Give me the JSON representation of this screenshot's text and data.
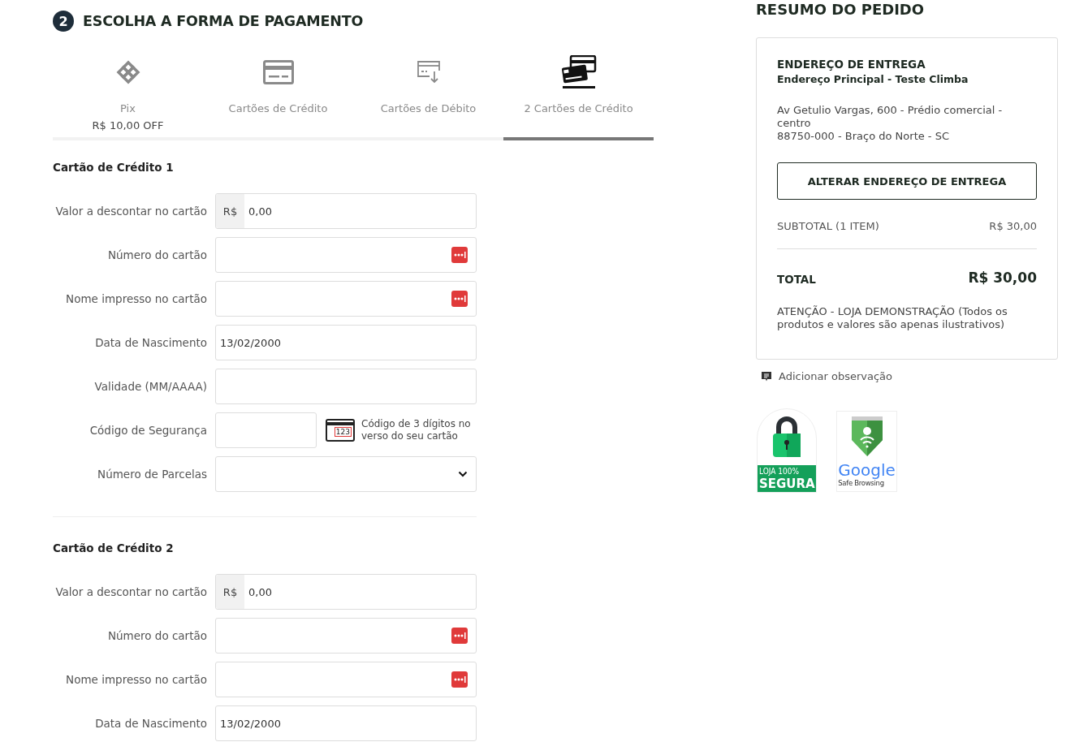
{
  "payment": {
    "step": "2",
    "title": "ESCOLHA A FORMA DE PAGAMENTO",
    "tabs": [
      {
        "kind": "pix",
        "label": "Pix",
        "note": "R$ 10,00 OFF",
        "selected": false
      },
      {
        "kind": "credit",
        "label": "Cartões de Crédito",
        "selected": false
      },
      {
        "kind": "debit",
        "label": "Cartões de Débito",
        "selected": false
      },
      {
        "kind": "two-cards",
        "label": "2 Cartões de Crédito",
        "selected": true
      }
    ],
    "cards": [
      {
        "title": "Cartão de Crédito 1",
        "fields": [
          {
            "kind": "money",
            "label": "Valor a descontar no cartão",
            "prefix": "R$",
            "value": "0,00"
          },
          {
            "kind": "protected",
            "label": "Número do cartão"
          },
          {
            "kind": "protected",
            "label": "Nome impresso no cartão"
          },
          {
            "kind": "text",
            "label": "Data de Nascimento",
            "value": "13/02/2000"
          },
          {
            "kind": "text",
            "label": "Validade (MM/AAAA)"
          },
          {
            "kind": "cvv",
            "label": "Código de Segurança",
            "hint": "Código de 3 dígitos no verso do seu cartão",
            "hint_icon_text": "123"
          },
          {
            "kind": "select",
            "label": "Número de Parcelas"
          }
        ]
      },
      {
        "title": "Cartão de Crédito 2",
        "fields": [
          {
            "kind": "money",
            "label": "Valor a descontar no cartão",
            "prefix": "R$",
            "value": "0,00"
          },
          {
            "kind": "protected",
            "label": "Número do cartão"
          },
          {
            "kind": "protected",
            "label": "Nome impresso no cartão"
          },
          {
            "kind": "text",
            "label": "Data de Nascimento",
            "value": "13/02/2000"
          }
        ]
      }
    ]
  },
  "summary": {
    "title": "RESUMO DO PEDIDO",
    "address_heading": "ENDEREÇO DE ENTREGA",
    "address_name": "Endereço Principal - Teste Climba",
    "address_lines": [
      "Av Getulio Vargas, 600 - Prédio comercial - centro",
      "88750-000 - Braço do Norte - SC"
    ],
    "change_button": "ALTERAR ENDEREÇO DE ENTREGA",
    "subtotal_label": "SUBTOTAL (1 ITEM)",
    "subtotal_value": "R$ 30,00",
    "total_label": "TOTAL",
    "total_value": "R$ 30,00",
    "notice": "ATENÇÃO - LOJA DEMONSTRAÇÃO (Todos os produtos e valores são apenas ilustrativos)",
    "add_note": "Adicionar observação",
    "badges": [
      {
        "kind": "secure",
        "line1": "LOJA 100%",
        "line2": "SEGURA"
      },
      {
        "kind": "google",
        "line1": "Google",
        "line2": "Safe Browsing"
      }
    ]
  }
}
